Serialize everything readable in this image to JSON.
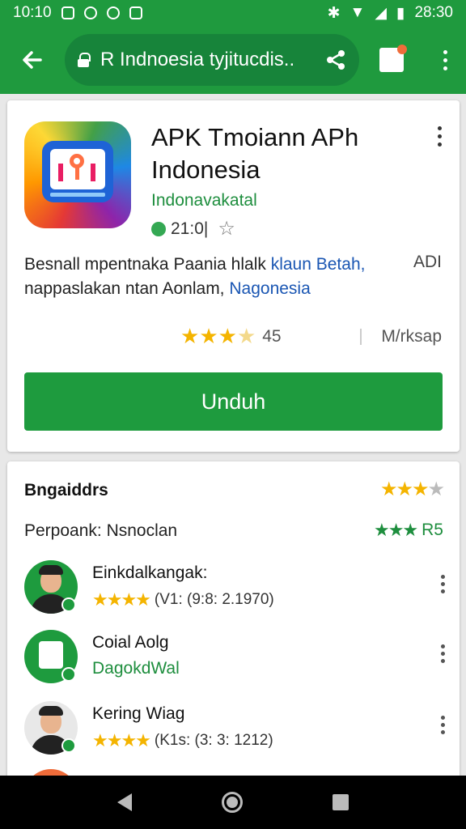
{
  "status_bar": {
    "time": "10:10",
    "right_time": "28:30"
  },
  "toolbar": {
    "url": "R Indnoesia tyjitucdis..",
    "accent_color": "#1f9a3e"
  },
  "app": {
    "title": "APK Tmoiann APh Indonesia",
    "developer": "Indonavakatal",
    "mini_rating": "21:0|",
    "description_part1": "Besnall mpentnaka Paania hlalk ",
    "description_link1": "klaun Betah,",
    "description_part2": "nappaslakan ntan Aonlam, ",
    "description_link2": "Nagonesia",
    "description_aside": "ADI",
    "rating_score": "45",
    "installs": "M/rksap",
    "download_label": "Unduh"
  },
  "reviews": {
    "title": "Bngaiddrs",
    "subtitle": "Perpoank: Nsnoclan",
    "score": "R5",
    "items": [
      {
        "name": "Einkdalkangak:",
        "meta": "(V1: (9:8: 2.1970)",
        "type": "photo"
      },
      {
        "name": "Coial Aolg",
        "meta": "DagokdWal",
        "type": "icon"
      },
      {
        "name": "Kering Wiag",
        "meta": "(K1s: (3: 3: 1212)",
        "type": "photo"
      }
    ]
  },
  "icons": [
    "back-arrow-icon",
    "lock-icon",
    "share-icon",
    "tab-switcher-icon",
    "overflow-menu-icon",
    "star-icon",
    "nav-back-icon",
    "nav-home-icon",
    "nav-recents-icon"
  ]
}
